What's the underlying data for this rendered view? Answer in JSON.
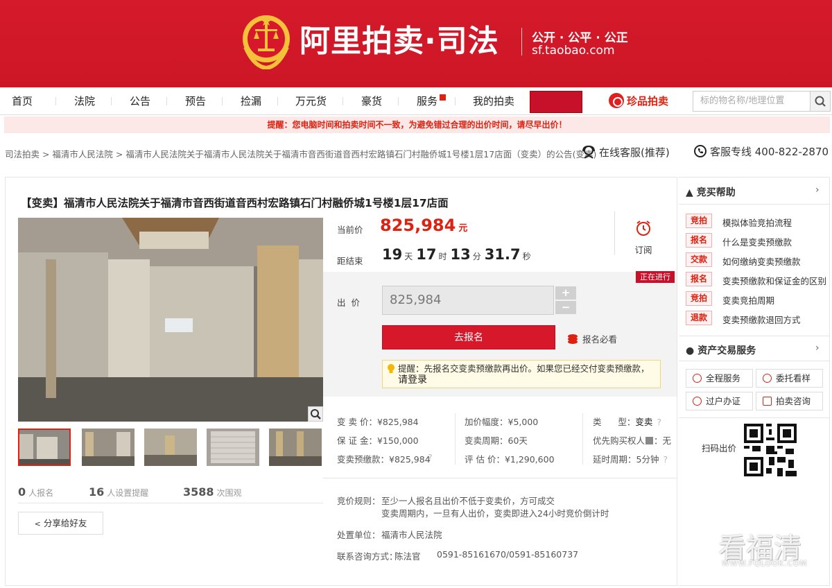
{
  "header": {
    "brand": "阿里拍卖·司法",
    "slogan": "公开 · 公平 · 公正",
    "domain": "sf.taobao.com"
  },
  "nav": {
    "items": [
      {
        "label": "首页"
      },
      {
        "label": "法院"
      },
      {
        "label": "公告"
      },
      {
        "label": "预告"
      },
      {
        "label": "捡漏"
      },
      {
        "label": "万元货"
      },
      {
        "label": "豪货"
      },
      {
        "label": "服务"
      },
      {
        "label": "我的拍卖"
      }
    ],
    "zhenpin": "珍品拍卖",
    "search_placeholder": "标的物名称/地理位置"
  },
  "notice": "提醒：您电脑时间和拍卖时间不一致，为避免错过合理的出价时间，请尽早出价！",
  "breadcrumb": "司法拍卖 > 福清市人民法院 > 福清市人民法院关于福清市人民法院关于福清市音西街道音西村宏路镇石门村融侨城1号楼1层17店面（变卖）的公告(变卖)",
  "service": {
    "online": "在线客服(推荐)",
    "hotline": "客服专线 400-822-2870"
  },
  "item": {
    "title": "【变卖】福清市人民法院关于福清市音西街道音西村宏路镇石门村融侨城1号楼1层17店面",
    "current_label": "当前价",
    "current_price": "825,984",
    "currency": "元",
    "end_label": "距结束",
    "countdown": {
      "days": "19",
      "days_u": "天",
      "hours": "17",
      "hours_u": "时",
      "mins": "13",
      "mins_u": "分",
      "secs": "31.7",
      "secs_u": "秒"
    },
    "subscribe": "订阅",
    "status": "正在进行",
    "bid_label": "出  价",
    "bid_value": "825,984",
    "plus": "+",
    "minus": "−",
    "register_btn": "去报名",
    "must_read": "报名必看",
    "tip_line1": "提醒：先报名交变卖预缴款再出价。如果您已经交付变卖预缴款，",
    "tip_line2": "请登录",
    "stats": [
      {
        "num": "0",
        "label": "人报名"
      },
      {
        "num": "16",
        "label": "人设置提醒"
      },
      {
        "num": "3588",
        "label": "次围观"
      }
    ],
    "share": "分享给好友"
  },
  "info": {
    "col1": [
      "变 卖 价：¥825,984",
      "保 证 金：¥150,000",
      "变卖预缴款：¥825,984"
    ],
    "col2": [
      "加价幅度：¥5,000",
      "变卖周期：60天",
      "评 估 价：¥1,290,600"
    ],
    "col3_type_label": "类      型：",
    "col3_type": "变卖",
    "col3_priority": "优先购买权人",
    "col3_priority_val": "：无",
    "col3_delay": "延时周期：5分钟"
  },
  "rules": {
    "label": "竞价规则：",
    "line1": "至少一人报名且出价不低于变卖价，方可成交",
    "line2": "变卖周期内，一旦有人出价，变卖即进入24小时竞价倒计时",
    "unit_label": "处置单位：",
    "unit": "福清市人民法院",
    "contact_label": "联系咨询方式：",
    "contact_name": "陈法官",
    "contact_phone": "0591-85161670/0591-85160737"
  },
  "sidebar": {
    "help_title": "竞买帮助",
    "help": [
      {
        "tag": "竞拍",
        "text": "模拟体验竞拍流程"
      },
      {
        "tag": "报名",
        "text": "什么是变卖预缴款"
      },
      {
        "tag": "交款",
        "text": "如何缴纳变卖预缴款"
      },
      {
        "tag": "报名",
        "text": "变卖预缴款和保证金的区别"
      },
      {
        "tag": "竞拍",
        "text": "变卖竞拍周期"
      },
      {
        "tag": "退款",
        "text": "变卖预缴款退回方式"
      }
    ],
    "asset_title": "资产交易服务",
    "services": [
      "全程服务",
      "委托看样",
      "过户办证",
      "拍卖咨询"
    ],
    "qr_label": "扫码出价"
  },
  "watermark": {
    "text": "看福清",
    "url": "WWW.FQLOOK.COM"
  },
  "colors": {
    "brand_red": "#d7182a",
    "price_red": "#dd2211"
  }
}
